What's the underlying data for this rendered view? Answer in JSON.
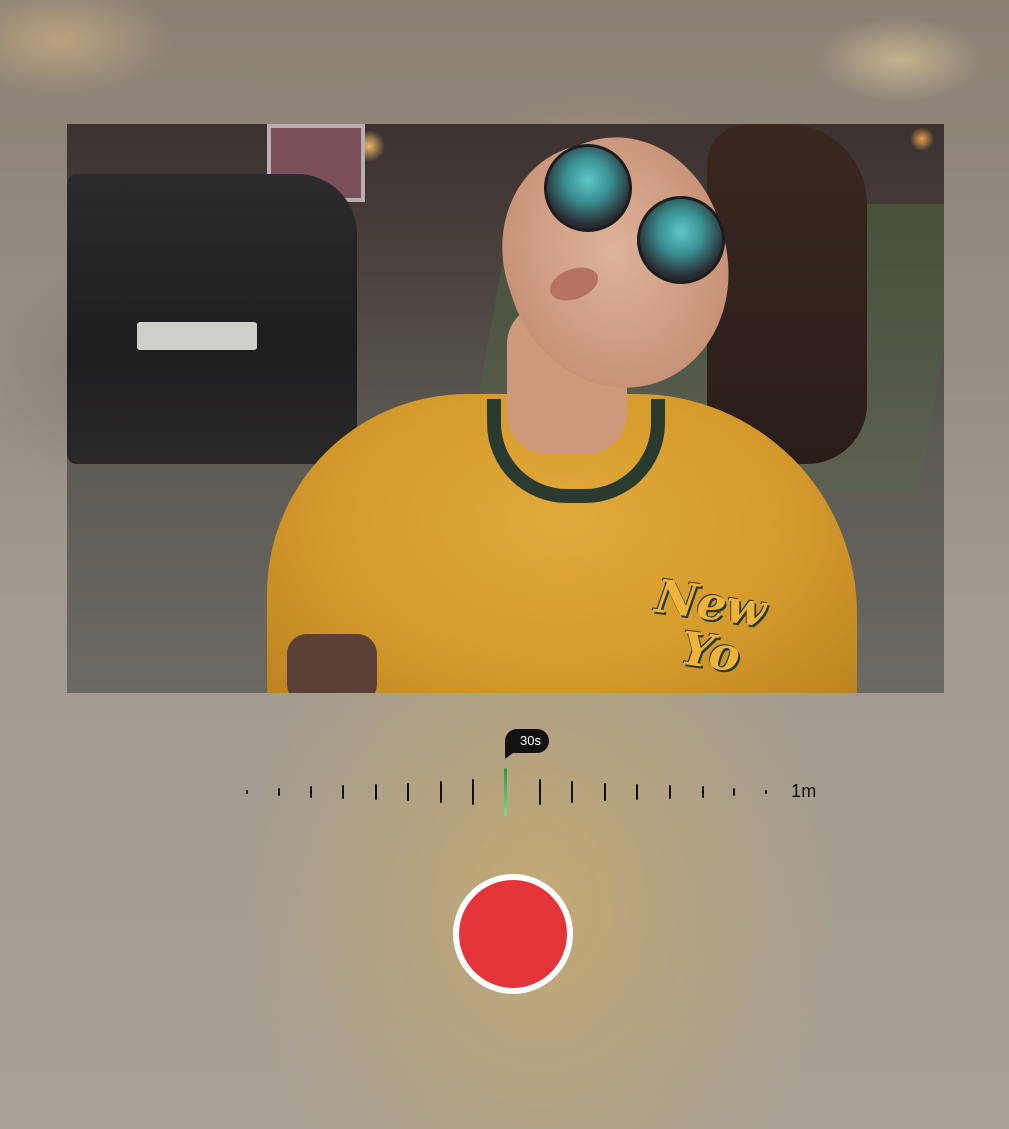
{
  "photo": {
    "shirt_text": "New\n  Yo"
  },
  "duration_ruler": {
    "current_label": "30s",
    "end_label": "1m",
    "marker_color": "#2a9a47"
  },
  "record_button": {
    "color": "#e4353a",
    "icon": "record-icon"
  }
}
